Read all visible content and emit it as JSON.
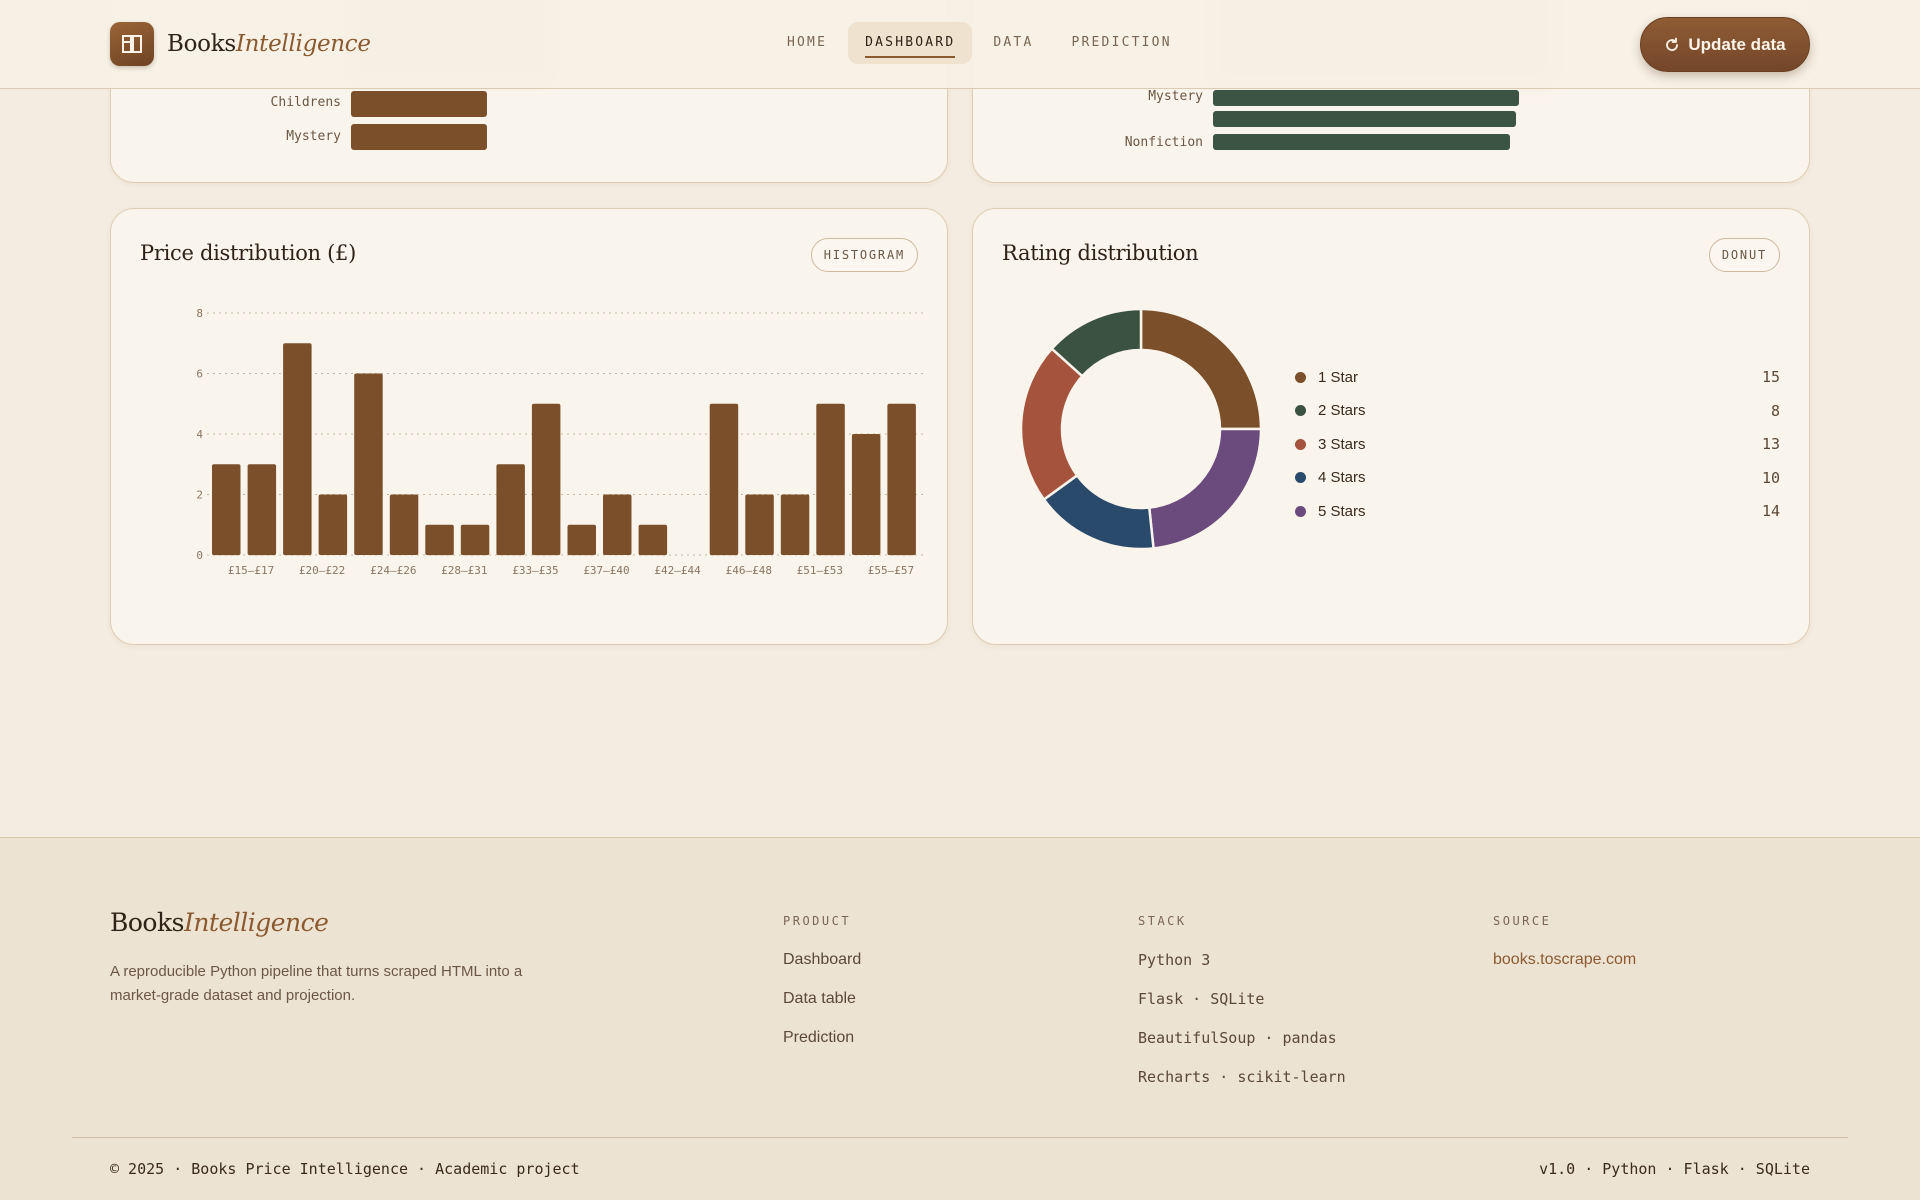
{
  "header": {
    "brand_main": "Books",
    "brand_accent": "Intelligence",
    "nav": [
      "HOME",
      "DASHBOARD",
      "DATA",
      "PREDICTION"
    ],
    "active_nav": "DASHBOARD",
    "update_label": "Update data"
  },
  "top_left_card": {
    "bars": [
      {
        "label": "Childrens"
      },
      {
        "label": "Mystery"
      }
    ],
    "color": "#7b4f2a"
  },
  "top_right_card": {
    "bars": [
      {
        "label": "Mystery"
      },
      {
        "label": ""
      },
      {
        "label": "Nonfiction"
      }
    ],
    "color": "#3c5442"
  },
  "price_card": {
    "title": "Price distribution (£)",
    "chip": "HISTOGRAM"
  },
  "rating_card": {
    "title": "Rating distribution",
    "chip": "DONUT"
  },
  "chart_data": [
    {
      "type": "bar",
      "title": "Price distribution (£)",
      "ylim": [
        0,
        8
      ],
      "yticks": [
        "0",
        "2",
        "4",
        "6",
        "8"
      ],
      "tick_labels": [
        "£15–£17",
        "£20–£22",
        "£24–£26",
        "£28–£31",
        "£33–£35",
        "£37–£40",
        "£42–£44",
        "£46–£48",
        "£51–£53",
        "£55–£57"
      ],
      "values": [
        3,
        3,
        7,
        2,
        6,
        2,
        1,
        1,
        3,
        5,
        1,
        2,
        1,
        0,
        5,
        2,
        2,
        5,
        4,
        5
      ],
      "color": "#7b4f2a",
      "grid": true
    },
    {
      "type": "pie",
      "title": "Rating distribution",
      "categories": [
        "1 Star",
        "2 Stars",
        "3 Stars",
        "4 Stars",
        "5 Stars"
      ],
      "values": [
        15,
        8,
        13,
        10,
        14
      ],
      "slice_order": [
        "1 Star",
        "5 Stars",
        "4 Stars",
        "3 Stars",
        "2 Stars"
      ],
      "colors": [
        "#7b4f2a",
        "#3b5240",
        "#a5533d",
        "#2a4a6b",
        "#6b4a7e"
      ]
    }
  ],
  "footer": {
    "brand_main": "Books",
    "brand_accent": "Intelligence",
    "description": "A reproducible Python pipeline that turns scraped HTML into a market-grade dataset and projection.",
    "columns": [
      {
        "heading": "PRODUCT",
        "links": [
          "Dashboard",
          "Data table",
          "Prediction"
        ]
      },
      {
        "heading": "STACK",
        "links": [
          "Python 3",
          "Flask · SQLite",
          "BeautifulSoup · pandas",
          "Recharts · scikit-learn"
        ]
      },
      {
        "heading": "SOURCE",
        "links": [
          "books.toscrape.com"
        ]
      }
    ],
    "copyright": "© 2025 · Books Price Intelligence · Academic project",
    "version": "v1.0 · Python · Flask · SQLite"
  }
}
